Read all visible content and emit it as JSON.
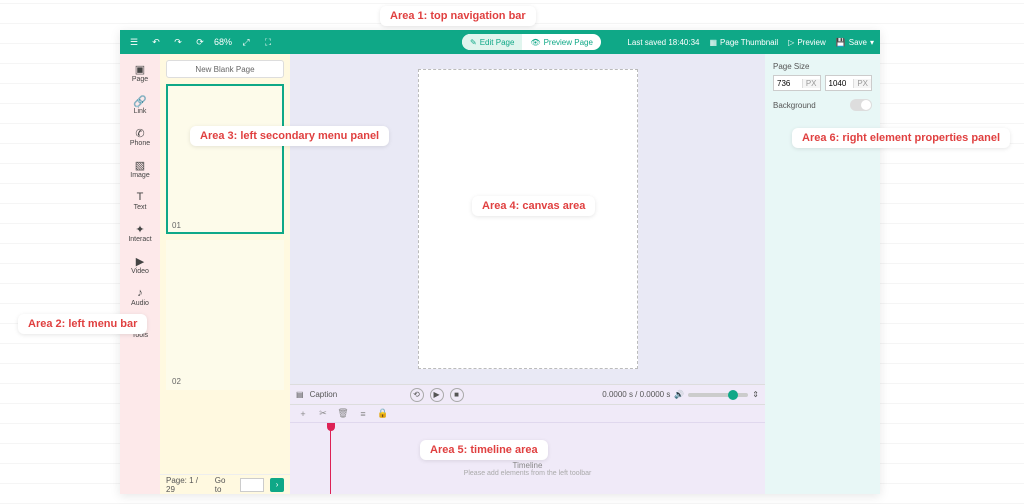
{
  "annotations": {
    "a1": "Area 1: top navigation bar",
    "a2": "Area 2: left menu bar",
    "a3": "Area 3: left secondary menu panel",
    "a4": "Area 4: canvas area",
    "a5": "Area 5: timeline area",
    "a6": "Area 6: right element properties panel"
  },
  "topnav": {
    "zoom": "68%",
    "edit_page": "Edit Page",
    "preview_page": "Preview Page",
    "last_saved": "Last saved 18:40:34",
    "page_thumbnail": "Page Thumbnail",
    "preview": "Preview",
    "save": "Save"
  },
  "leftbar": {
    "items": [
      "Page",
      "Link",
      "Phone",
      "Image",
      "Text",
      "Interact",
      "Video",
      "Audio",
      "Tools"
    ]
  },
  "secpanel": {
    "new_blank": "New Blank Page",
    "thumb1": "01",
    "thumb2": "02",
    "page_label": "Page: 1 / 29",
    "goto_label": "Go to"
  },
  "timeline": {
    "caption": "Caption",
    "time": "0.0000 s / 0.0000 s",
    "empty_title": "Timeline",
    "empty_sub": "Please add elements from the left toolbar"
  },
  "props": {
    "page_size": "Page Size",
    "w": "736",
    "h": "1040",
    "unit": "PX",
    "background": "Background"
  }
}
